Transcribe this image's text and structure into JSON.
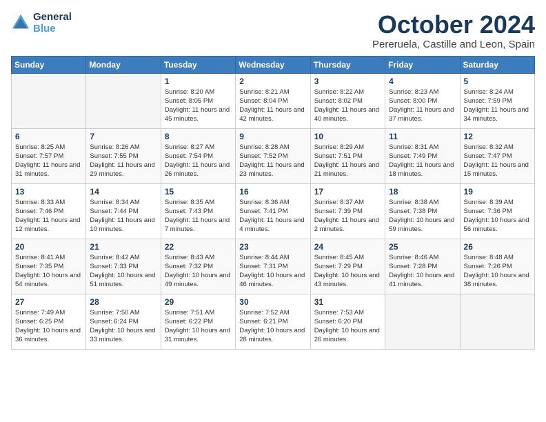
{
  "header": {
    "logo_line1": "General",
    "logo_line2": "Blue",
    "month_title": "October 2024",
    "location": "Pereruela, Castille and Leon, Spain"
  },
  "days_of_week": [
    "Sunday",
    "Monday",
    "Tuesday",
    "Wednesday",
    "Thursday",
    "Friday",
    "Saturday"
  ],
  "weeks": [
    [
      {
        "num": "",
        "info": ""
      },
      {
        "num": "",
        "info": ""
      },
      {
        "num": "1",
        "info": "Sunrise: 8:20 AM\nSunset: 8:05 PM\nDaylight: 11 hours and 45 minutes."
      },
      {
        "num": "2",
        "info": "Sunrise: 8:21 AM\nSunset: 8:04 PM\nDaylight: 11 hours and 42 minutes."
      },
      {
        "num": "3",
        "info": "Sunrise: 8:22 AM\nSunset: 8:02 PM\nDaylight: 11 hours and 40 minutes."
      },
      {
        "num": "4",
        "info": "Sunrise: 8:23 AM\nSunset: 8:00 PM\nDaylight: 11 hours and 37 minutes."
      },
      {
        "num": "5",
        "info": "Sunrise: 8:24 AM\nSunset: 7:59 PM\nDaylight: 11 hours and 34 minutes."
      }
    ],
    [
      {
        "num": "6",
        "info": "Sunrise: 8:25 AM\nSunset: 7:57 PM\nDaylight: 11 hours and 31 minutes."
      },
      {
        "num": "7",
        "info": "Sunrise: 8:26 AM\nSunset: 7:55 PM\nDaylight: 11 hours and 29 minutes."
      },
      {
        "num": "8",
        "info": "Sunrise: 8:27 AM\nSunset: 7:54 PM\nDaylight: 11 hours and 26 minutes."
      },
      {
        "num": "9",
        "info": "Sunrise: 8:28 AM\nSunset: 7:52 PM\nDaylight: 11 hours and 23 minutes."
      },
      {
        "num": "10",
        "info": "Sunrise: 8:29 AM\nSunset: 7:51 PM\nDaylight: 11 hours and 21 minutes."
      },
      {
        "num": "11",
        "info": "Sunrise: 8:31 AM\nSunset: 7:49 PM\nDaylight: 11 hours and 18 minutes."
      },
      {
        "num": "12",
        "info": "Sunrise: 8:32 AM\nSunset: 7:47 PM\nDaylight: 11 hours and 15 minutes."
      }
    ],
    [
      {
        "num": "13",
        "info": "Sunrise: 8:33 AM\nSunset: 7:46 PM\nDaylight: 11 hours and 12 minutes."
      },
      {
        "num": "14",
        "info": "Sunrise: 8:34 AM\nSunset: 7:44 PM\nDaylight: 11 hours and 10 minutes."
      },
      {
        "num": "15",
        "info": "Sunrise: 8:35 AM\nSunset: 7:43 PM\nDaylight: 11 hours and 7 minutes."
      },
      {
        "num": "16",
        "info": "Sunrise: 8:36 AM\nSunset: 7:41 PM\nDaylight: 11 hours and 4 minutes."
      },
      {
        "num": "17",
        "info": "Sunrise: 8:37 AM\nSunset: 7:39 PM\nDaylight: 11 hours and 2 minutes."
      },
      {
        "num": "18",
        "info": "Sunrise: 8:38 AM\nSunset: 7:38 PM\nDaylight: 10 hours and 59 minutes."
      },
      {
        "num": "19",
        "info": "Sunrise: 8:39 AM\nSunset: 7:36 PM\nDaylight: 10 hours and 56 minutes."
      }
    ],
    [
      {
        "num": "20",
        "info": "Sunrise: 8:41 AM\nSunset: 7:35 PM\nDaylight: 10 hours and 54 minutes."
      },
      {
        "num": "21",
        "info": "Sunrise: 8:42 AM\nSunset: 7:33 PM\nDaylight: 10 hours and 51 minutes."
      },
      {
        "num": "22",
        "info": "Sunrise: 8:43 AM\nSunset: 7:32 PM\nDaylight: 10 hours and 49 minutes."
      },
      {
        "num": "23",
        "info": "Sunrise: 8:44 AM\nSunset: 7:31 PM\nDaylight: 10 hours and 46 minutes."
      },
      {
        "num": "24",
        "info": "Sunrise: 8:45 AM\nSunset: 7:29 PM\nDaylight: 10 hours and 43 minutes."
      },
      {
        "num": "25",
        "info": "Sunrise: 8:46 AM\nSunset: 7:28 PM\nDaylight: 10 hours and 41 minutes."
      },
      {
        "num": "26",
        "info": "Sunrise: 8:48 AM\nSunset: 7:26 PM\nDaylight: 10 hours and 38 minutes."
      }
    ],
    [
      {
        "num": "27",
        "info": "Sunrise: 7:49 AM\nSunset: 6:25 PM\nDaylight: 10 hours and 36 minutes."
      },
      {
        "num": "28",
        "info": "Sunrise: 7:50 AM\nSunset: 6:24 PM\nDaylight: 10 hours and 33 minutes."
      },
      {
        "num": "29",
        "info": "Sunrise: 7:51 AM\nSunset: 6:22 PM\nDaylight: 10 hours and 31 minutes."
      },
      {
        "num": "30",
        "info": "Sunrise: 7:52 AM\nSunset: 6:21 PM\nDaylight: 10 hours and 28 minutes."
      },
      {
        "num": "31",
        "info": "Sunrise: 7:53 AM\nSunset: 6:20 PM\nDaylight: 10 hours and 26 minutes."
      },
      {
        "num": "",
        "info": ""
      },
      {
        "num": "",
        "info": ""
      }
    ]
  ]
}
